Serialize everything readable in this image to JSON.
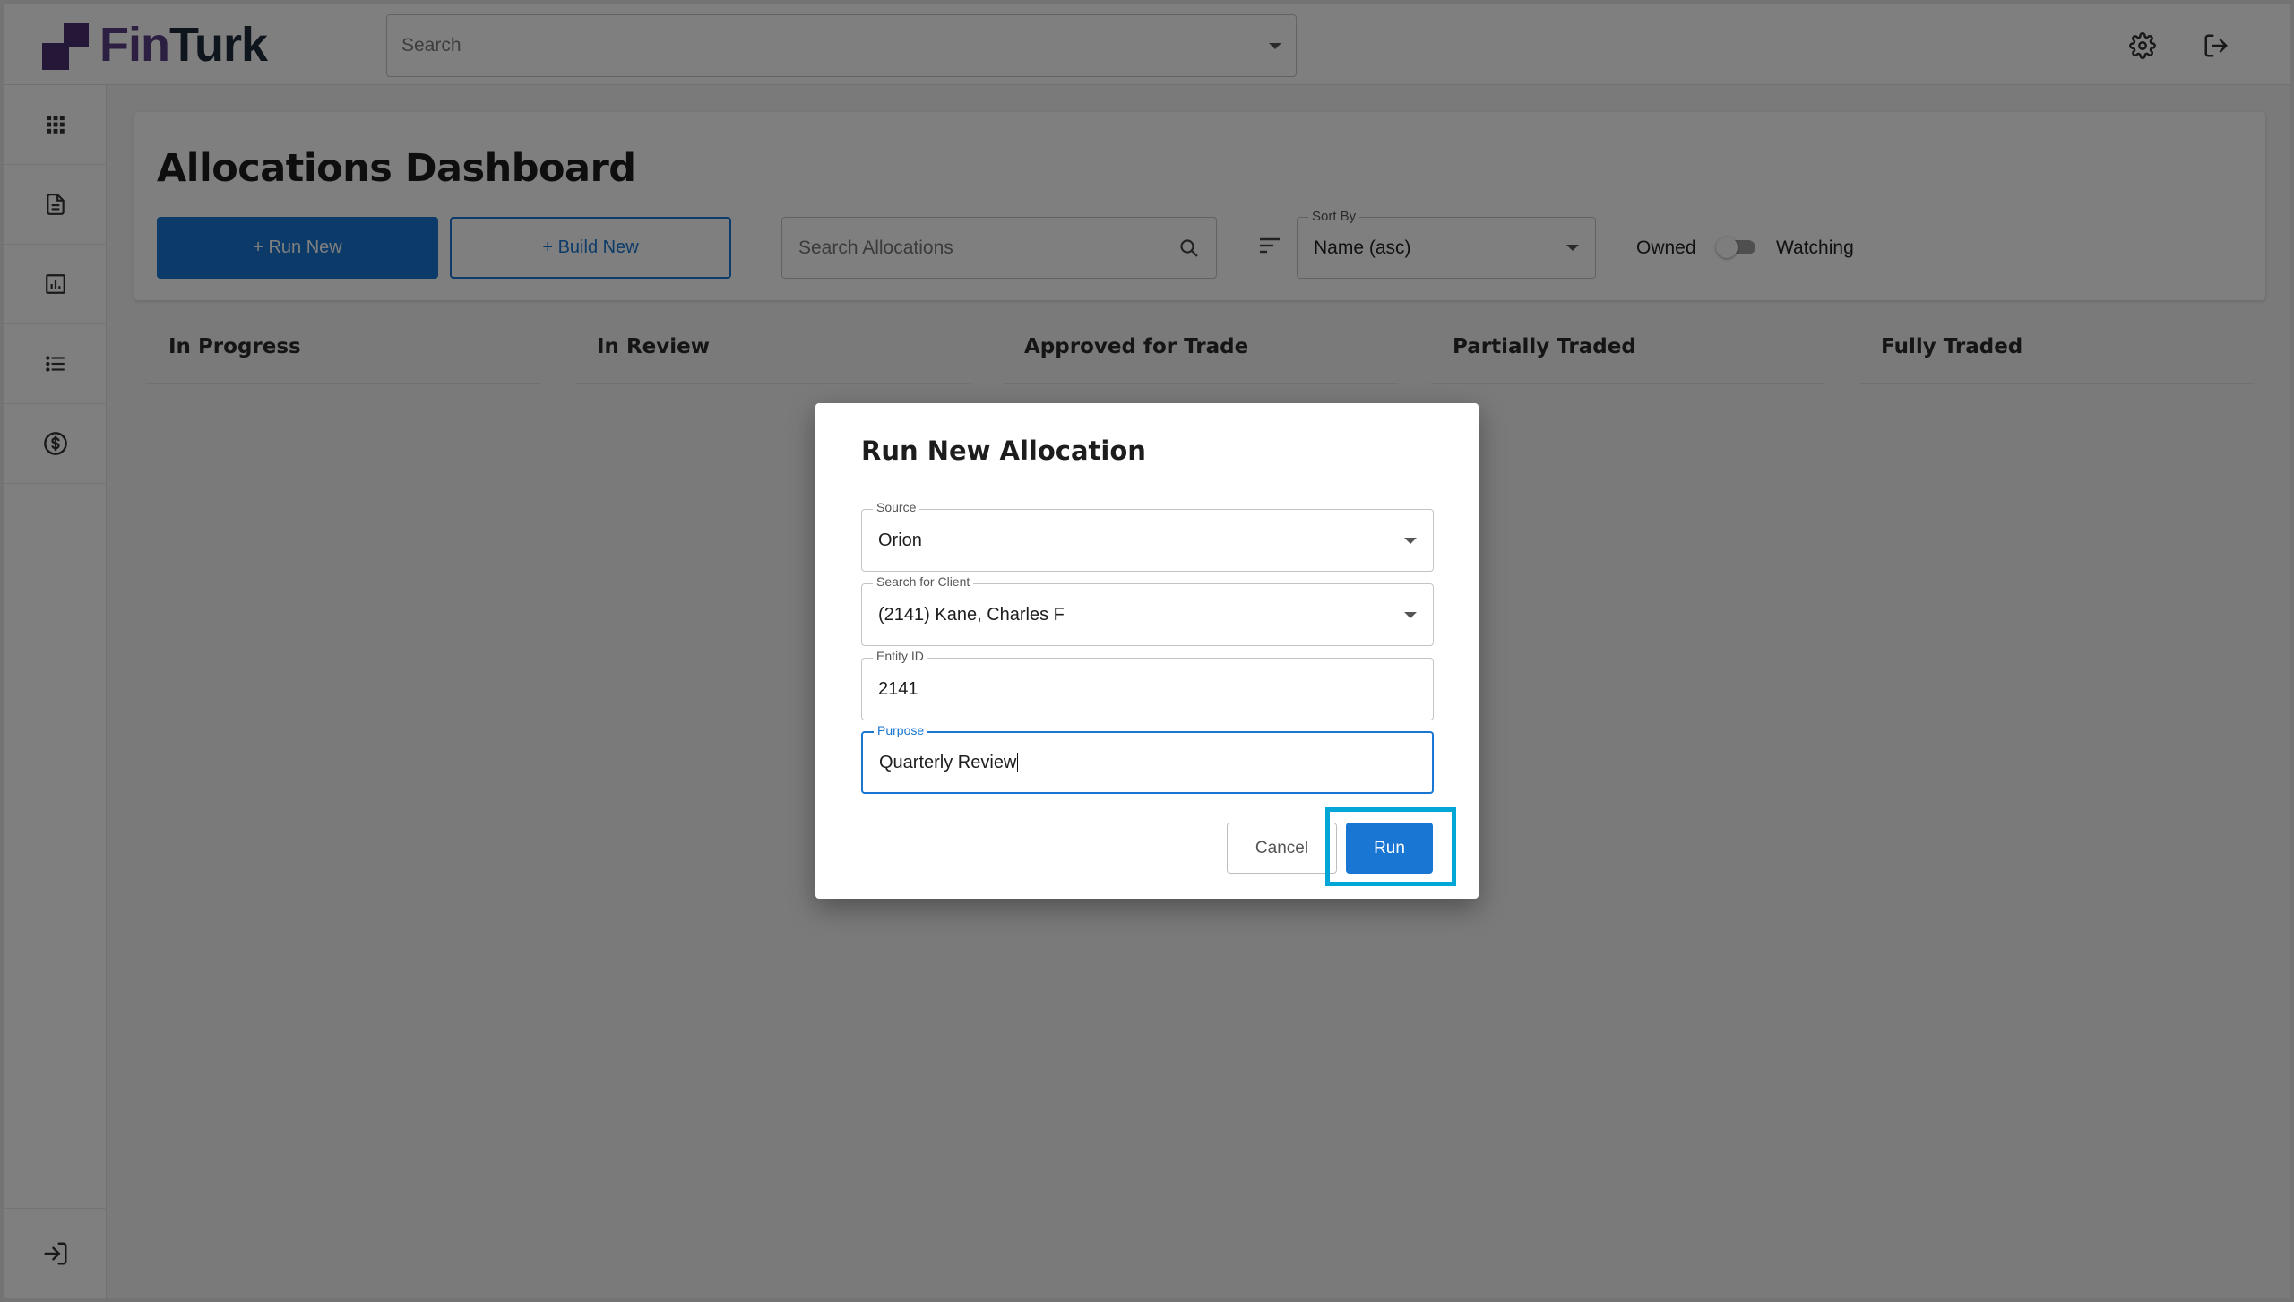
{
  "app": {
    "logo_fin": "Fin",
    "logo_turk": "Turk"
  },
  "topbar": {
    "search_placeholder": "Search"
  },
  "sidebar": {
    "items": [
      {
        "icon": "grid-icon"
      },
      {
        "icon": "document-icon"
      },
      {
        "icon": "chart-icon"
      },
      {
        "icon": "list-icon"
      },
      {
        "icon": "dollar-icon"
      }
    ],
    "bottom_icon": "login-icon"
  },
  "dashboard": {
    "title": "Allocations Dashboard",
    "run_new_label": "+ Run New",
    "build_new_label": "+ Build New",
    "search_placeholder": "Search Allocations",
    "sort_label": "Sort By",
    "sort_value": "Name (asc)",
    "owned_label": "Owned",
    "watching_label": "Watching",
    "toggle_on": false
  },
  "columns": [
    "In Progress",
    "In Review",
    "Approved for Trade",
    "Partially Traded",
    "Fully Traded"
  ],
  "dialog": {
    "title": "Run New Allocation",
    "source_label": "Source",
    "source_value": "Orion",
    "client_label": "Search for Client",
    "client_value": "(2141) Kane, Charles F",
    "entity_label": "Entity ID",
    "entity_value": "2141",
    "purpose_label": "Purpose",
    "purpose_value": "Quarterly Review",
    "cancel_label": "Cancel",
    "run_label": "Run"
  },
  "colors": {
    "primary": "#1976d2",
    "brand": "#4b2e6e",
    "highlight": "#00a6d6"
  }
}
